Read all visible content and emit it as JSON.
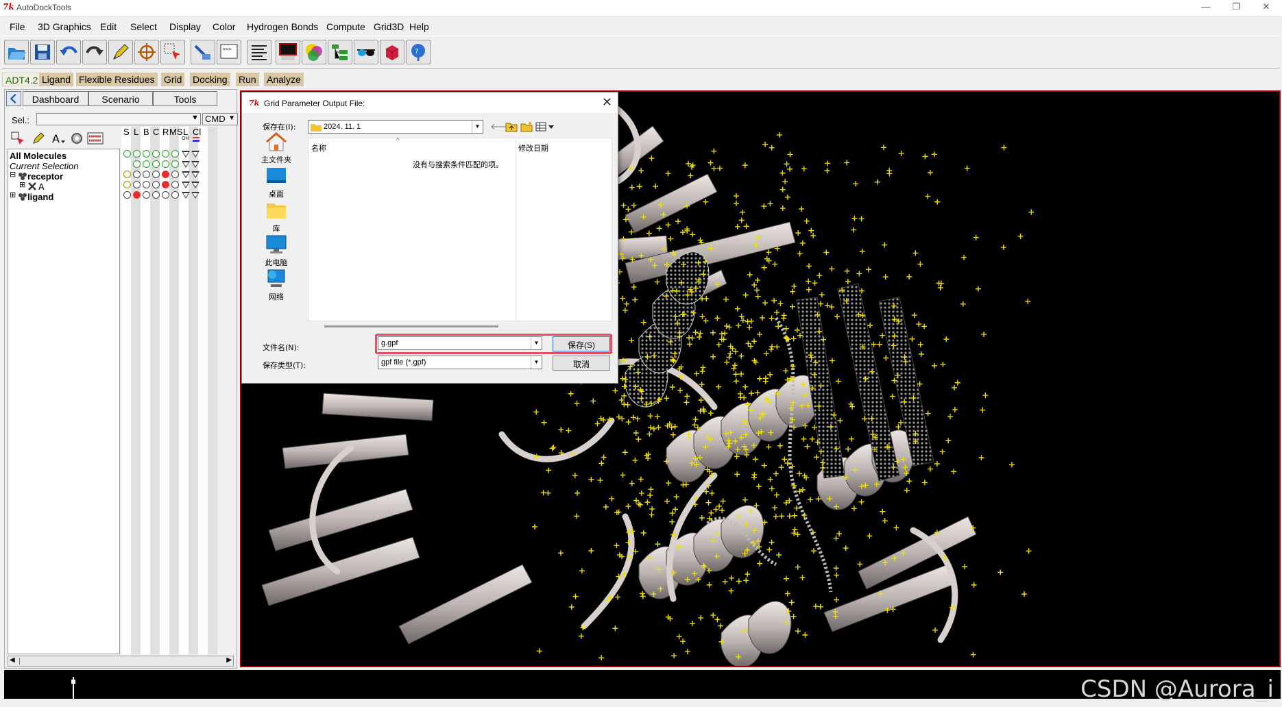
{
  "window": {
    "title": "AutoDockTools",
    "tk_logo": "7k",
    "controls": [
      "—",
      "❐",
      "✕"
    ]
  },
  "menubar": [
    "File",
    "3D Graphics",
    "Edit",
    "Select",
    "Display",
    "Color",
    "Hydrogen Bonds",
    "Compute",
    "Grid3D",
    "Help"
  ],
  "toolbar": {
    "icons": [
      "open-folder-icon",
      "save-disk-icon",
      "undo-icon",
      "redo-icon",
      "pencil-icon",
      "center-target-icon",
      "select-region-icon",
      "pick-hand-icon",
      "python-shell-icon",
      "text-lines-icon",
      "monitor-icon",
      "color-sphere-icon",
      "molecule-tree-icon",
      "stereo-glasses-icon",
      "cube-icon",
      "help-bubble-icon"
    ]
  },
  "adt_menu": [
    "ADT4.2",
    "Ligand",
    "Flexible Residues",
    "Grid",
    "Docking",
    "Run",
    "Analyze"
  ],
  "left_panel": {
    "tabs": [
      "Dashboard",
      "Scenario",
      "Tools"
    ],
    "sel_label": "Sel.:",
    "sel_value": "",
    "cmd_label": "CMD",
    "column_headers": [
      "S",
      "L",
      "B",
      "C",
      "R",
      "MS",
      "L",
      "Cl"
    ],
    "sub_headers": [
      "OH"
    ],
    "tree": {
      "all_molecules": "All Molecules",
      "current_selection": "Current Selection",
      "receptor": "receptor",
      "chain_a": "A",
      "ligand": "ligand"
    }
  },
  "dialog": {
    "title": "Grid Parameter Output File:",
    "save_in_label": "保存在(I):",
    "save_in_value": "2024. 11. 1",
    "places": [
      "主文件夹",
      "桌面",
      "库",
      "此电脑",
      "网络"
    ],
    "columns": [
      "名称",
      "修改日期"
    ],
    "empty_message": "没有与搜索条件匹配的项。",
    "filename_label": "文件名(N):",
    "filename_value": "g.gpf",
    "filetype_label": "保存类型(T):",
    "filetype_value": "gpf file (*.gpf)",
    "save_button": "保存(S)",
    "cancel_button": "取消"
  },
  "watermark": "CSDN @Aurora_i"
}
